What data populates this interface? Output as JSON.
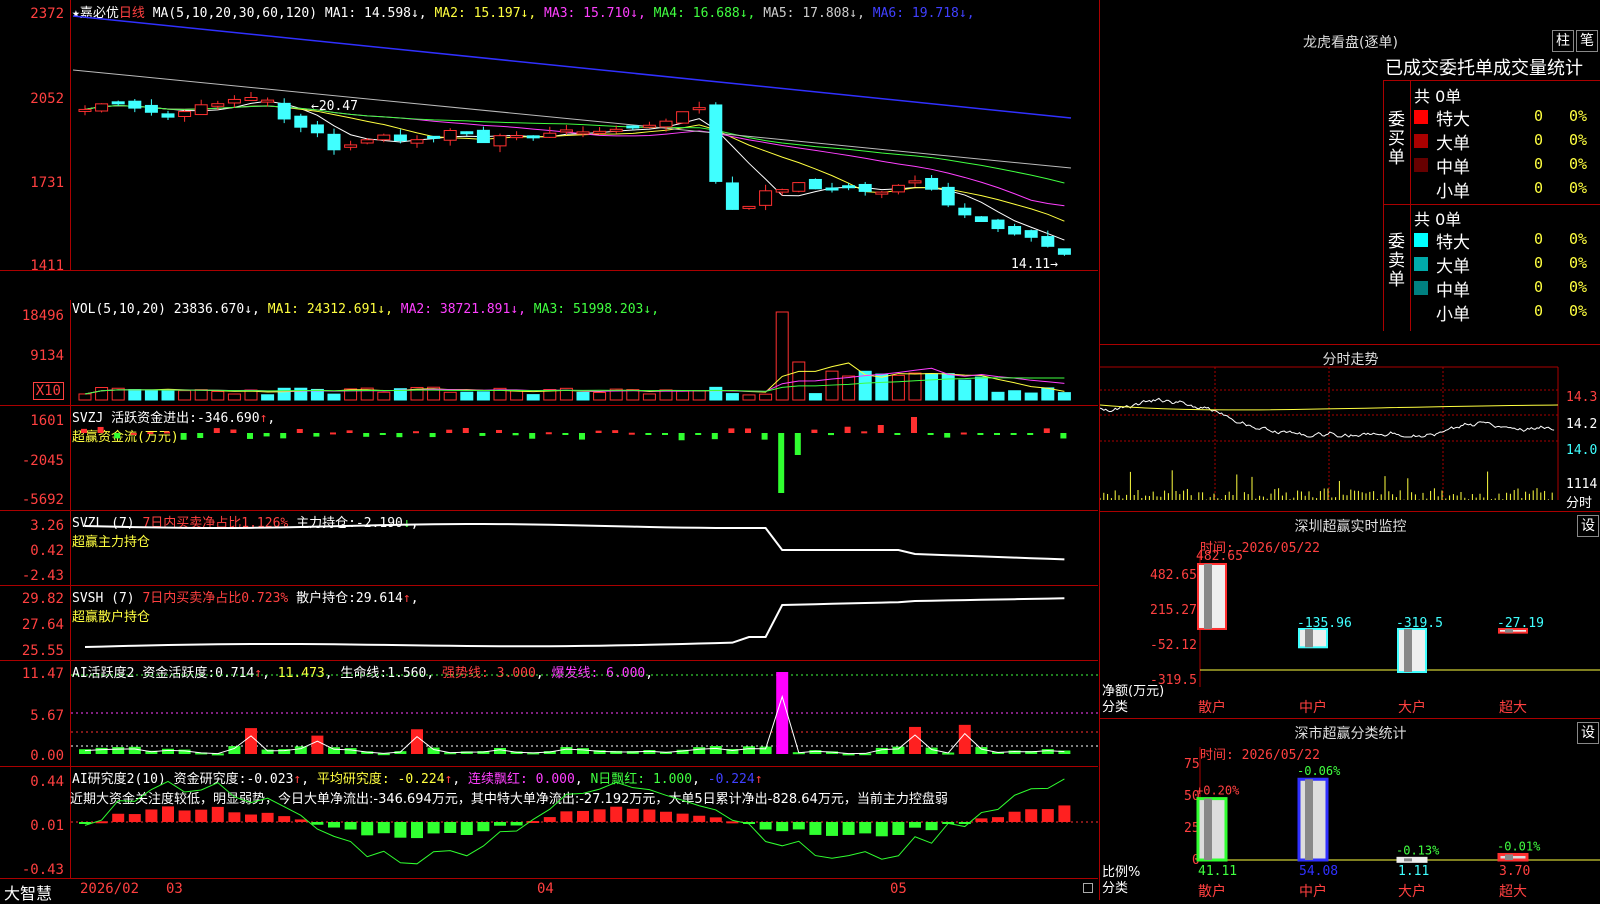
{
  "main": {
    "stock_name": "嘉必优",
    "period": "日线",
    "ma_header": "MA(5,10,20,30,60,120)",
    "ma": [
      {
        "label": "MA1:",
        "value": "14.598",
        "arrow": "↓",
        "color": "#ffffff"
      },
      {
        "label": "MA2:",
        "value": "15.197",
        "arrow": "↓",
        "color": "#ffff40"
      },
      {
        "label": "MA3:",
        "value": "15.710",
        "arrow": "↓",
        "color": "#ff40ff"
      },
      {
        "label": "MA4:",
        "value": "16.688",
        "arrow": "↓",
        "color": "#40ff40"
      },
      {
        "label": "MA5:",
        "value": "17.808",
        "arrow": "↓",
        "color": "#cccccc"
      },
      {
        "label": "MA6:",
        "value": "19.718",
        "arrow": "↓",
        "color": "#4040ff"
      }
    ],
    "y_labels": [
      "2372",
      "2052",
      "1731",
      "1411"
    ],
    "high_note": "20.47",
    "low_note": "14.11"
  },
  "vol": {
    "header": "VOL(5,10,20)",
    "value": "23836.670",
    "ma": [
      {
        "label": "MA1:",
        "value": "24312.691",
        "color": "#ffff40"
      },
      {
        "label": "MA2:",
        "value": "38721.891",
        "color": "#ff40ff"
      },
      {
        "label": "MA3:",
        "value": "51998.203",
        "color": "#40ff40"
      }
    ],
    "y_labels": [
      "18496",
      "9134"
    ],
    "unit": "X10"
  },
  "svzj": {
    "header": "SVZJ",
    "label": "活跃资金进出:",
    "value": "-346.690",
    "sub": "超赢资金流(万元)",
    "y_labels": [
      "1601",
      "-2045",
      "-5692"
    ]
  },
  "svzl": {
    "header": "SVZL (7)",
    "text1": "7日内买卖净占比1.126%",
    "label": "主力持仓:",
    "value": "-2.190",
    "sub": "超赢主力持仓",
    "y_labels": [
      "3.26",
      "0.42",
      "-2.43"
    ]
  },
  "svsh": {
    "header": "SVSH (7)",
    "text1": "7日内买卖净占比0.723%",
    "label": "散户持仓:",
    "value": "29.614",
    "sub": "超赢散户持仓",
    "y_labels": [
      "29.82",
      "27.64",
      "25.55"
    ]
  },
  "ai1": {
    "header": "AI活跃度2",
    "label": "资金活跃度:",
    "value": "0.714",
    "v2": "11.473",
    "life_label": "生命线:",
    "life_value": "1.560",
    "strong": "强势线: 3.000",
    "burst": "爆发线: 6.000",
    "y_labels": [
      "11.47",
      "5.67",
      "0.00"
    ]
  },
  "ai2": {
    "header": "AI研究度2(10)",
    "label": "资金研究度:",
    "value": "-0.023",
    "avg": "平均研究度: -0.224",
    "cont": "连续飘红: 0.000",
    "nday": "N日飘红: 1.000",
    "last": "-0.224",
    "text": "近期大资金关注度较低，明显弱势，今日大单净流出:-346.694万元，其中特大单净流出:-27.192万元，大单5日累计净出-828.64万元，当前主力控盘弱",
    "y_labels": [
      "0.44",
      "0.01",
      "-0.43"
    ]
  },
  "footer": {
    "brand": "大智慧",
    "dates": [
      "2026/02",
      "03",
      "04",
      "05"
    ]
  },
  "dragon": {
    "title": "龙虎看盘(逐单)",
    "btn1": "柱",
    "btn2": "笔",
    "subtitle": "已成交委托单成交量统计",
    "buy_label": "委买单",
    "sell_label": "委卖单",
    "buy_total": "共 0单",
    "sell_total": "共 0单",
    "buy_rows": [
      {
        "name": "特大",
        "count": "0",
        "pct": "0%",
        "color": "#ff0000"
      },
      {
        "name": "大单",
        "count": "0",
        "pct": "0%",
        "color": "#aa0000"
      },
      {
        "name": "中单",
        "count": "0",
        "pct": "0%",
        "color": "#660000"
      },
      {
        "name": "小单",
        "count": "0",
        "pct": "0%",
        "color": "#000000"
      }
    ],
    "sell_rows": [
      {
        "name": "特大",
        "count": "0",
        "pct": "0%",
        "color": "#00ffff"
      },
      {
        "name": "大单",
        "count": "0",
        "pct": "0%",
        "color": "#00aaaa"
      },
      {
        "name": "中单",
        "count": "0",
        "pct": "0%",
        "color": "#008080"
      },
      {
        "name": "小单",
        "count": "0",
        "pct": "0%",
        "color": "#000000"
      }
    ]
  },
  "intraday": {
    "title": "分时走势",
    "y_labels": [
      "14.3",
      "14.2",
      "14.0"
    ],
    "vol_label": "1114",
    "time_label": "分时"
  },
  "sz_monitor": {
    "title": "深圳超赢实时监控",
    "btn": "设",
    "time": "时间: 2026/05/22",
    "y_labels": [
      "482.65",
      "215.27",
      "-52.12",
      "-319.5"
    ],
    "ylabel": "净额(万元)",
    "xlabel": "分类",
    "categories": [
      "散户",
      "中户",
      "大户",
      "超大"
    ],
    "values": [
      "482.65",
      "-135.96",
      "-319.5",
      "-27.19"
    ]
  },
  "sz_class": {
    "title": "深市超赢分类统计",
    "btn": "设",
    "time": "时间: 2026/05/22",
    "y_labels": [
      "75",
      "50",
      "25",
      "0"
    ],
    "ylabel": "比例%",
    "xlabel": "分类",
    "categories": [
      "散户",
      "中户",
      "大户",
      "超大"
    ],
    "top_values": [
      "+0.20%",
      "-0.06%",
      "-0.13%",
      "-0.01%"
    ],
    "bottom_values": [
      "41.11",
      "54.08",
      "1.11",
      "3.70"
    ]
  },
  "chart_data": {
    "type": "bar",
    "title": "深圳超赢实时监控",
    "categories": [
      "散户",
      "中户",
      "大户",
      "超大"
    ],
    "values": [
      482.65,
      -135.96,
      -319.5,
      -27.19
    ],
    "ylabel": "净额(万元)",
    "ylim": [
      -319.5,
      482.65
    ]
  }
}
